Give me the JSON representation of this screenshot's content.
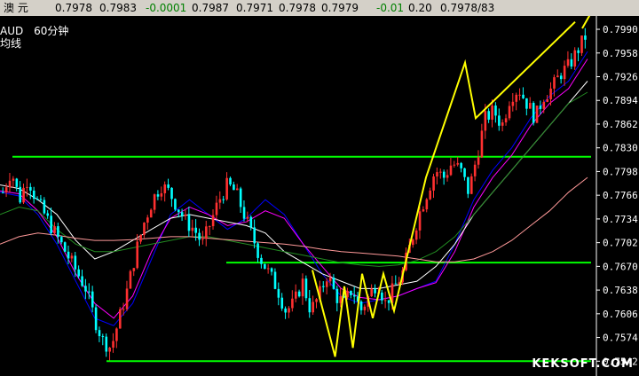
{
  "quote_bar": {
    "name": "澳 元",
    "v1": "0.7978",
    "v2": "0.7983",
    "change": "-0.0001",
    "v3": "0.7987",
    "v4": "0.7971",
    "v5": "0.7978",
    "v6": "0.7979",
    "change_pct": "-0.01",
    "v7": "0.20",
    "v8": "0.7978/83"
  },
  "symbol": "AUD",
  "period": "60分钟",
  "ma_label": "均线",
  "watermark": "KEKSOFT.COM",
  "colors": {
    "background": "#000000",
    "support_line": "#00ff00",
    "trend_line": "#ffff00",
    "axis_text": "#ffffff"
  },
  "chart_data": {
    "type": "candlestick",
    "y_ticks": [
      "0.7990",
      "0.7958",
      "0.7926",
      "0.7894",
      "0.7862",
      "0.7830",
      "0.7798",
      "0.7766",
      "0.7734",
      "0.7702",
      "0.7670",
      "0.7638",
      "0.7606",
      "0.7574",
      "0.7542"
    ],
    "ylim": [
      0.7522,
      0.8008
    ],
    "horizontal_levels": [
      0.7818,
      0.7675,
      0.7542
    ],
    "close_path": [
      0.777,
      0.78,
      0.776,
      0.779,
      0.776,
      0.774,
      0.772,
      0.77,
      0.768,
      0.766,
      0.764,
      0.76,
      0.757,
      0.756,
      0.76,
      0.764,
      0.769,
      0.773,
      0.776,
      0.778,
      0.777,
      0.775,
      0.773,
      0.772,
      0.77,
      0.773,
      0.776,
      0.778,
      0.777,
      0.774,
      0.771,
      0.768,
      0.766,
      0.764,
      0.761,
      0.762,
      0.765,
      0.761,
      0.763,
      0.766,
      0.763,
      0.762,
      0.764,
      0.761,
      0.763,
      0.765,
      0.762,
      0.764,
      0.766,
      0.77,
      0.774,
      0.777,
      0.78,
      0.779,
      0.781,
      0.78,
      0.777,
      0.782,
      0.787,
      0.788,
      0.786,
      0.79,
      0.791,
      0.789,
      0.787,
      0.79,
      0.791,
      0.793,
      0.794,
      0.796,
      0.798
    ],
    "trend_points": [
      [
        0.762,
        0.7665
      ],
      [
        0.7652,
        0.7548
      ],
      [
        0.7665,
        0.7643
      ],
      [
        0.7677,
        0.756
      ],
      [
        0.769,
        0.766
      ],
      [
        0.7705,
        0.76
      ],
      [
        0.772,
        0.766
      ],
      [
        0.7735,
        0.761
      ],
      [
        0.778,
        0.779
      ],
      [
        0.7835,
        0.7945
      ],
      [
        0.785,
        0.787
      ],
      [
        0.799,
        0.8
      ]
    ],
    "ma_series": [
      {
        "color": "#0000ff",
        "values": [
          0.777,
          0.7765,
          0.774,
          0.77,
          0.765,
          0.76,
          0.759,
          0.762,
          0.768,
          0.774,
          0.776,
          0.774,
          0.772,
          0.7735,
          0.776,
          0.774,
          0.77,
          0.766,
          0.763,
          0.762,
          0.7625,
          0.763,
          0.764,
          0.765,
          0.77,
          0.776,
          0.78,
          0.783,
          0.787,
          0.79,
          0.792,
          0.796
        ]
      },
      {
        "color": "#ff00ff",
        "values": [
          0.7772,
          0.7768,
          0.7745,
          0.771,
          0.766,
          0.762,
          0.76,
          0.763,
          0.769,
          0.7735,
          0.775,
          0.774,
          0.7725,
          0.773,
          0.7745,
          0.7735,
          0.77,
          0.767,
          0.764,
          0.7628,
          0.7625,
          0.763,
          0.764,
          0.7648,
          0.769,
          0.775,
          0.779,
          0.782,
          0.786,
          0.789,
          0.791,
          0.795
        ]
      },
      {
        "color": "#ffffff",
        "values": [
          0.778,
          0.7775,
          0.776,
          0.774,
          0.7705,
          0.768,
          0.769,
          0.7705,
          0.772,
          0.7735,
          0.774,
          0.7735,
          0.773,
          0.7725,
          0.7715,
          0.769,
          0.7675,
          0.766,
          0.765,
          0.764,
          0.764,
          0.7645,
          0.765,
          0.767,
          0.77,
          0.774,
          0.777,
          0.78,
          0.783,
          0.786,
          0.789,
          0.792
        ]
      },
      {
        "color": "#228b22",
        "values": [
          0.774,
          0.775,
          0.7745,
          0.772,
          0.77,
          0.769,
          0.769,
          0.7695,
          0.77,
          0.7705,
          0.771,
          0.771,
          0.7705,
          0.77,
          0.7695,
          0.769,
          0.7685,
          0.768,
          0.7675,
          0.7672,
          0.767,
          0.7672,
          0.7678,
          0.769,
          0.771,
          0.774,
          0.777,
          0.78,
          0.783,
          0.786,
          0.789,
          0.7905
        ]
      },
      {
        "color": "#ff9999",
        "values": [
          0.77,
          0.771,
          0.7715,
          0.7712,
          0.7708,
          0.7705,
          0.7705,
          0.7706,
          0.7708,
          0.771,
          0.771,
          0.7708,
          0.7706,
          0.7704,
          0.7702,
          0.77,
          0.7697,
          0.7693,
          0.769,
          0.7688,
          0.7686,
          0.7684,
          0.768,
          0.7676,
          0.7676,
          0.768,
          0.769,
          0.7705,
          0.7725,
          0.7745,
          0.777,
          0.779
        ]
      }
    ]
  }
}
